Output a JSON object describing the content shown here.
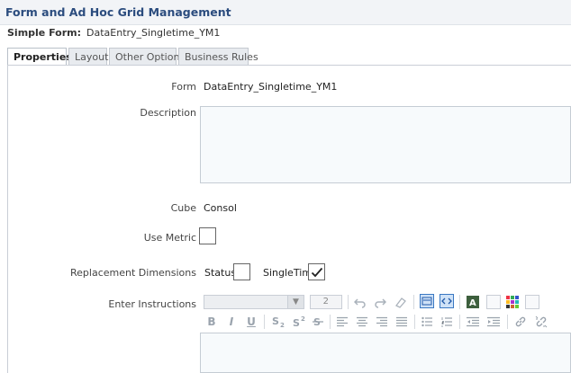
{
  "window": {
    "title": "Form and Ad Hoc Grid Management"
  },
  "form_header": {
    "label": "Simple Form:",
    "name": "DataEntry_Singletime_YM1"
  },
  "tabs": [
    {
      "label": "Properties",
      "active": true
    },
    {
      "label": "Layout",
      "active": false
    },
    {
      "label": "Other Options",
      "active": false
    },
    {
      "label": "Business Rules",
      "active": false
    }
  ],
  "properties": {
    "form_label": "Form",
    "form_value": "DataEntry_Singletime_YM1",
    "description_label": "Description",
    "description_value": "",
    "cube_label": "Cube",
    "cube_value": "Consol",
    "use_metric_label": "Use Metric",
    "use_metric_checked": false,
    "replacement_label": "Replacement Dimensions",
    "status_label": "Status",
    "status_checked": false,
    "singletime_label": "SingleTime",
    "singletime_checked": true,
    "instructions_label": "Enter Instructions",
    "font_size_value": "2"
  },
  "editor": {
    "format_buttons": [
      "B",
      "I",
      "U"
    ],
    "colors": {
      "accent": "#2b4c7e",
      "active_button": "#cfe2f7"
    }
  }
}
